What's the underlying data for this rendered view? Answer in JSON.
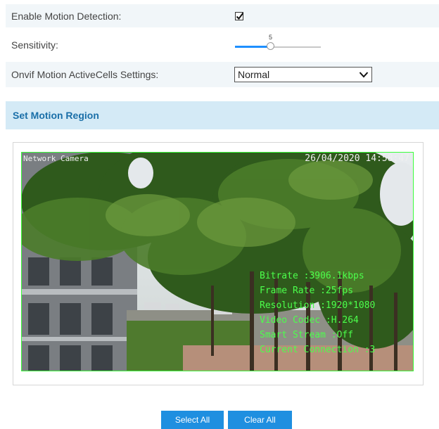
{
  "settings": {
    "motion_detection": {
      "label": "Enable Motion Detection:",
      "checked": true
    },
    "sensitivity": {
      "label": "Sensitivity:",
      "value": "5",
      "fraction": 0.42
    },
    "activecells": {
      "label": "Onvif Motion ActiveCells Settings:",
      "value": "Normal"
    }
  },
  "section": {
    "title": "Set Motion Region"
  },
  "video": {
    "camera_name": "Network Camera",
    "timestamp": "26/04/2020 14:58:47",
    "info": [
      "Bitrate :3906.1kbps",
      "Frame Rate :25fps",
      "Resolution :1920*1080",
      "Video Codec :H.264",
      "Smart Stream :Off",
      "Current Connection :3"
    ]
  },
  "buttons": {
    "select_all": "Select All",
    "clear_all": "Clear All"
  },
  "colors": {
    "accent": "#1f8fe0",
    "section_bg": "#d4eaf6",
    "section_text": "#1a6fa8",
    "osd_green": "#4cff4c"
  }
}
